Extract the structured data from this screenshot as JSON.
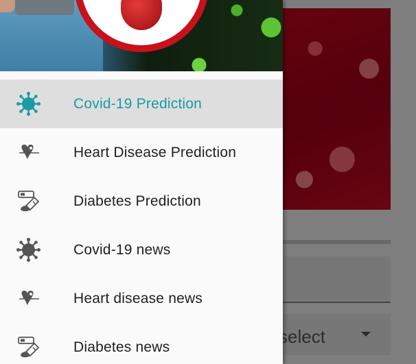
{
  "background": {
    "select_text": "select"
  },
  "drawer": {
    "items": [
      {
        "label": "Covid-19 Prediction",
        "icon": "virus-icon",
        "active": true
      },
      {
        "label": "Heart Disease Prediction",
        "icon": "heart-pulse-icon",
        "active": false
      },
      {
        "label": "Diabetes Prediction",
        "icon": "glucose-meter-icon",
        "active": false
      },
      {
        "label": "Covid-19 news",
        "icon": "virus-icon",
        "active": false
      },
      {
        "label": "Heart disease news",
        "icon": "heart-pulse-icon",
        "active": false
      },
      {
        "label": "Diabetes news",
        "icon": "glucose-meter-icon",
        "active": false
      }
    ]
  },
  "colors": {
    "accent": "#1a9aa5",
    "active_bg": "#dedede",
    "icon_inactive": "#555555"
  }
}
